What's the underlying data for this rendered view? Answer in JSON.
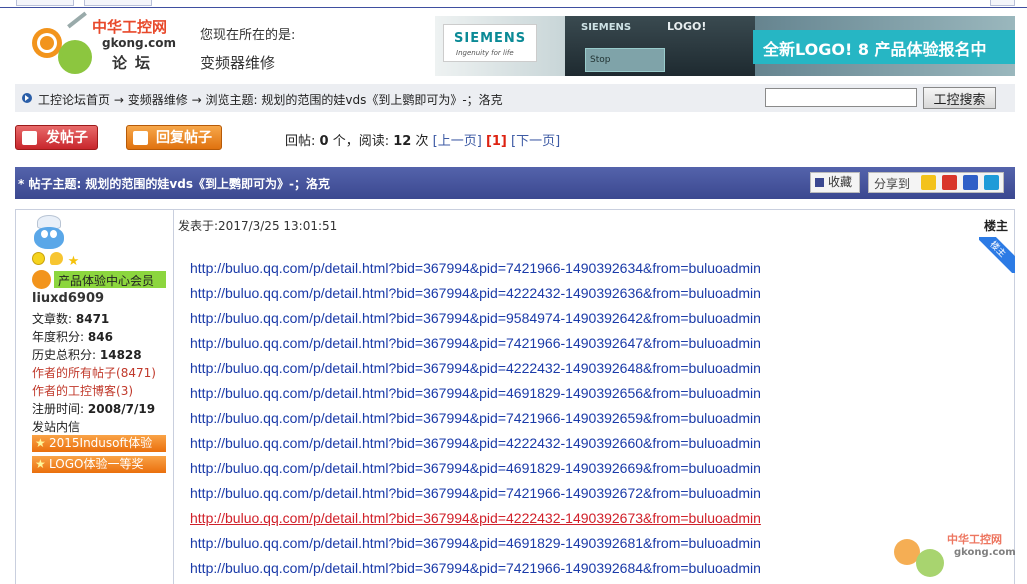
{
  "header": {
    "logo": {
      "site_name": "中华工控网",
      "domain": "gkong.com",
      "section": "论坛"
    },
    "location_label": "您现在所在的是:",
    "location_value": "变频器维修",
    "banner": {
      "brand": "SIEMENS",
      "tagline": "Ingenuity for life",
      "device_brand": "SIEMENS",
      "device_logo": "LOGO!",
      "device_screen": "Stop",
      "promo": "全新LOGO! 8 产品体验报名中"
    }
  },
  "breadcrumb": {
    "home": "工控论坛首页",
    "sep": "→",
    "category": "变频器维修",
    "browse_label": "浏览主题:",
    "topic": "规划的范围的娃vds《到上鹦即可为》-；洛克"
  },
  "search": {
    "value": "",
    "button_label": "工控搜索"
  },
  "actions": {
    "new_topic": "发帖子",
    "reply": "回复帖子"
  },
  "stats": {
    "replies_label": "回帖:",
    "replies": "0",
    "replies_unit": "个，阅读:",
    "reads": "12",
    "reads_unit": "次",
    "prev": "[上一页]",
    "current": "[1]",
    "next": "[下一页]"
  },
  "topic_bar": {
    "title": "* 帖子主题: 规划的范围的娃vds《到上鹦即可为》-；洛克",
    "favorite": "收藏",
    "share_label": "分享到",
    "share_colors": [
      "#f3c21b",
      "#d9362b",
      "#2f5fc7",
      "#1f9bd8"
    ]
  },
  "author": {
    "member_level": "产品体验中心会员",
    "username": "liuxd6909",
    "articles_label": "文章数:",
    "articles": "8471",
    "year_points_label": "年度积分:",
    "year_points": "846",
    "total_points_label": "历史总积分:",
    "total_points": "14828",
    "all_posts_label": "作者的所有帖子",
    "all_posts_count": "(8471)",
    "blog_label": "作者的工控博客",
    "blog_count": "(3)",
    "register_label": "注册时间:",
    "register_date": "2008/7/19",
    "send_message": "发站内信",
    "medals": [
      "2015Indusoft体验",
      "LOGO体验一等奖"
    ]
  },
  "post": {
    "posted_label": "发表于:",
    "posted_time": "2017/3/25 13:01:51",
    "owner_label": "楼主",
    "ribbon": "楼主",
    "links": [
      "http://buluo.qq.com/p/detail.html?bid=367994&pid=7421966-1490392634&from=buluoadmin",
      "http://buluo.qq.com/p/detail.html?bid=367994&pid=4222432-1490392636&from=buluoadmin",
      "http://buluo.qq.com/p/detail.html?bid=367994&pid=9584974-1490392642&from=buluoadmin",
      "http://buluo.qq.com/p/detail.html?bid=367994&pid=7421966-1490392647&from=buluoadmin",
      "http://buluo.qq.com/p/detail.html?bid=367994&pid=4222432-1490392648&from=buluoadmin",
      "http://buluo.qq.com/p/detail.html?bid=367994&pid=4691829-1490392656&from=buluoadmin",
      "http://buluo.qq.com/p/detail.html?bid=367994&pid=7421966-1490392659&from=buluoadmin",
      "http://buluo.qq.com/p/detail.html?bid=367994&pid=4222432-1490392660&from=buluoadmin",
      "http://buluo.qq.com/p/detail.html?bid=367994&pid=4691829-1490392669&from=buluoadmin",
      "http://buluo.qq.com/p/detail.html?bid=367994&pid=7421966-1490392672&from=buluoadmin",
      "http://buluo.qq.com/p/detail.html?bid=367994&pid=4222432-1490392673&from=buluoadmin",
      "http://buluo.qq.com/p/detail.html?bid=367994&pid=4691829-1490392681&from=buluoadmin",
      "http://buluo.qq.com/p/detail.html?bid=367994&pid=7421966-1490392684&from=buluoadmin"
    ],
    "visited_link_index": 10
  },
  "watermark": {
    "site_name": "中华工控网",
    "domain": "gkong.com"
  }
}
